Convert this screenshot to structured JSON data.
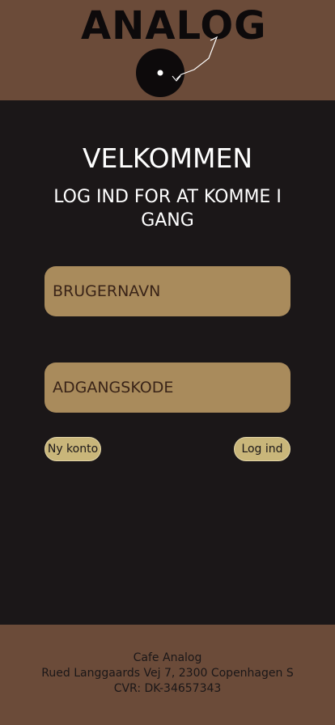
{
  "header": {
    "logo_text": "ANALOG"
  },
  "main": {
    "welcome": "VELKOMMEN",
    "subtitle": "LOG IND FOR AT KOMME I GANG",
    "username_placeholder": "BRUGERNAVN",
    "password_placeholder": "ADGANGSKODE",
    "new_account_label": "Ny konto",
    "login_label": "Log ind"
  },
  "footer": {
    "name": "Cafe Analog",
    "address": "Rued Langgaards Vej 7, 2300 Copenhagen S",
    "cvr": "CVR: DK-34657343"
  },
  "colors": {
    "header_bg": "#6b4b39",
    "main_bg": "#1b1718",
    "field_bg": "#a98b5c",
    "button_bg": "#c9b67a"
  }
}
